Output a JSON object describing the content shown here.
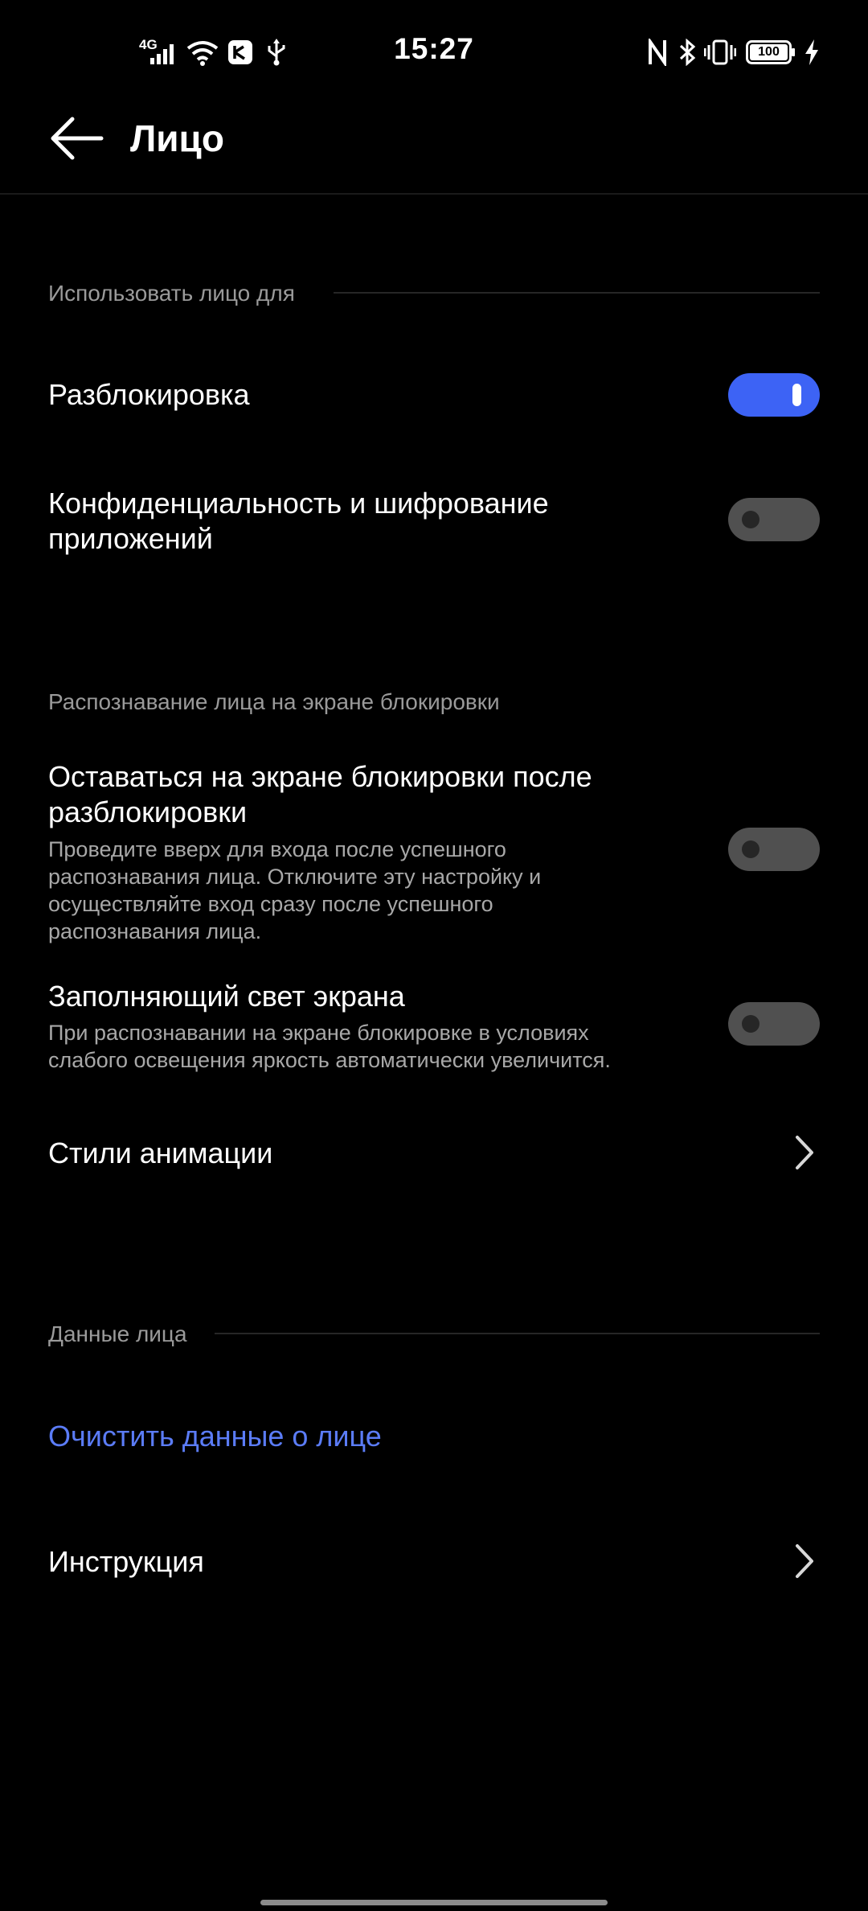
{
  "status_bar": {
    "time": "15:27",
    "network_type": "4G",
    "battery_level": "100",
    "icons_left": [
      "signal-icon",
      "wifi-icon",
      "app-notification-icon",
      "usb-icon"
    ],
    "icons_right": [
      "nfc-icon",
      "bluetooth-icon",
      "vibrate-icon",
      "battery-icon",
      "charging-icon"
    ]
  },
  "header": {
    "title": "Лицо"
  },
  "sections": {
    "use_face": {
      "header": "Использовать лицо для",
      "unlock": {
        "title": "Разблокировка",
        "enabled": true
      },
      "privacy": {
        "title_line1": "Конфиденциальность и шифрование",
        "title_line2": "приложений",
        "enabled": false
      }
    },
    "lockscreen": {
      "header": "Распознавание лица на экране блокировки",
      "stay_on_lock": {
        "title_line1": "Оставаться на экране блокировки после",
        "title_line2": "разблокировки",
        "desc_line1": "Проведите вверх для входа после успешного",
        "desc_line2": "распознавания лица. Отключите эту настройку и",
        "desc_line3": "осуществляйте вход сразу после успешного",
        "desc_line4": "распознавания лица.",
        "enabled": false
      },
      "fill_light": {
        "title": "Заполняющий свет экрана",
        "desc_line1": "При распознавании на экране блокировке в условиях",
        "desc_line2": "слабого освещения яркость автоматически увеличится.",
        "enabled": false
      },
      "animation_styles": {
        "title": "Стили анимации"
      }
    },
    "face_data": {
      "header": "Данные лица",
      "clear": "Очистить данные о лице",
      "instructions": "Инструкция"
    }
  },
  "colors": {
    "background": "#000000",
    "accent": "#3d63f5",
    "link": "#5b7cf7",
    "toggle_off": "#505050",
    "secondary_text": "#a8a8a8"
  }
}
